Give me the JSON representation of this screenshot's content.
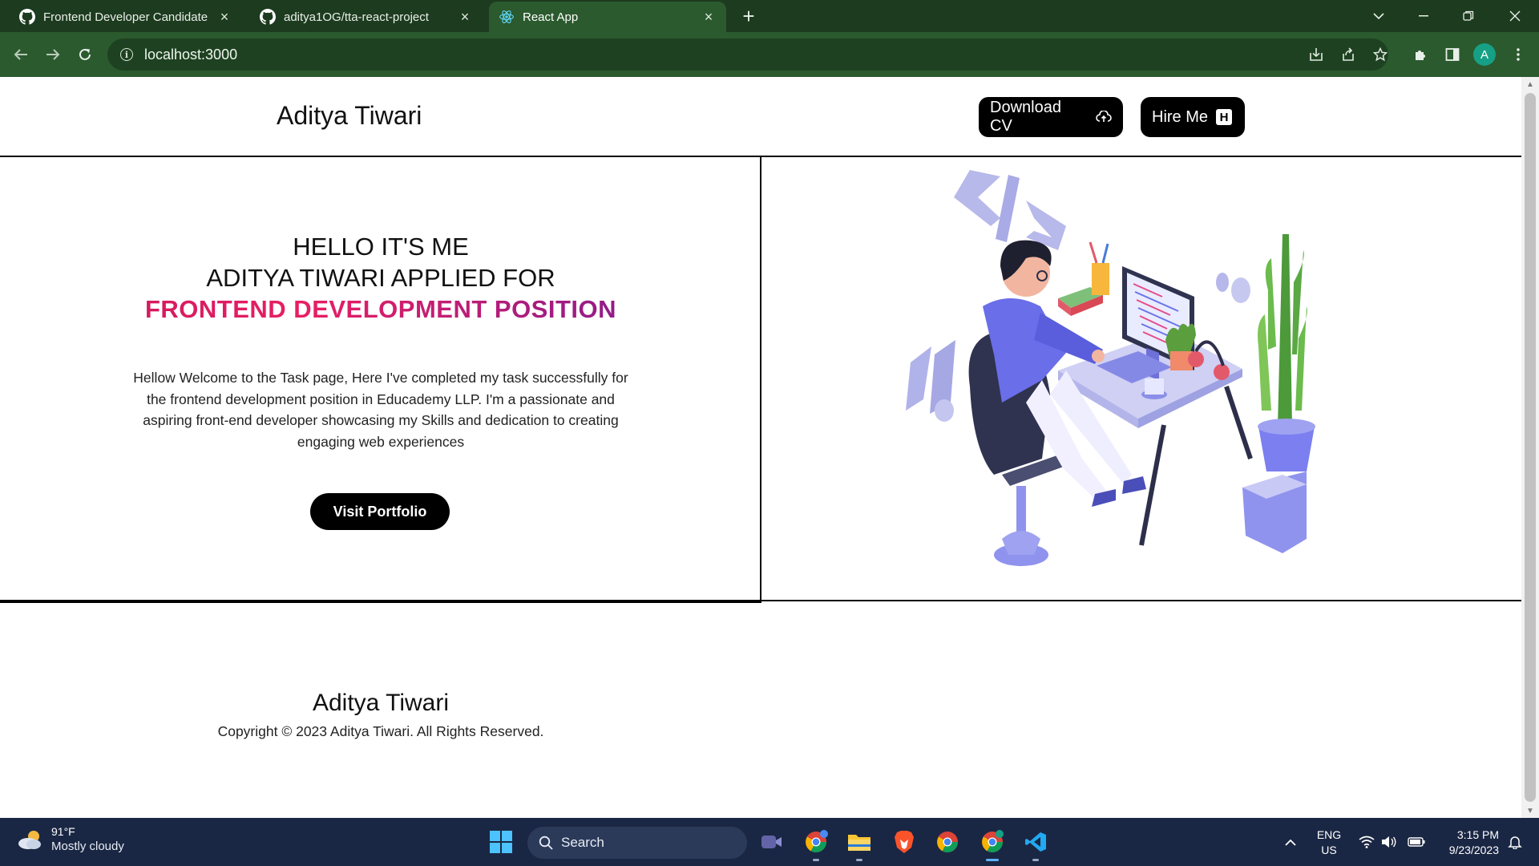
{
  "browser": {
    "tabs": [
      {
        "title": "Frontend Developer Candidate S",
        "icon": "github-icon"
      },
      {
        "title": "aditya1OG/tta-react-project",
        "icon": "github-icon"
      },
      {
        "title": "React App",
        "icon": "react-icon",
        "active": true
      }
    ],
    "url": "localhost:3000",
    "profile_initial": "A"
  },
  "header": {
    "brand": "Aditya Tiwari",
    "download_cv_label": "Download CV",
    "hire_me_label": "Hire Me",
    "hire_me_badge": "H"
  },
  "hero": {
    "line1": "HELLO IT'S ME",
    "line2": "ADITYA TIWARI APPLIED FOR",
    "line3": "FRONTEND DEVELOPMENT POSITION",
    "description": "Hellow Welcome to the Task page, Here I've completed my task successfully for the frontend development position in Educademy LLP. I'm a passionate and aspiring front-end developer showcasing my Skills and dedication to creating engaging web experiences",
    "visit_portfolio_label": "Visit Portfolio"
  },
  "footer": {
    "name": "Aditya Tiwari",
    "copyright": "Copyright © 2023 Aditya Tiwari. All Rights Reserved."
  },
  "taskbar": {
    "weather_temp": "91°F",
    "weather_condition": "Mostly cloudy",
    "search_placeholder": "Search",
    "lang_line1": "ENG",
    "lang_line2": "US",
    "time": "3:15 PM",
    "date": "9/23/2023"
  },
  "colors": {
    "chrome_dark": "#1d3b1f",
    "chrome_toolbar": "#2b5a2e",
    "accent_gradient_start": "#c2185b",
    "accent_gradient_end": "#6a1b9a",
    "illustration_purple": "#7b7ff0"
  }
}
